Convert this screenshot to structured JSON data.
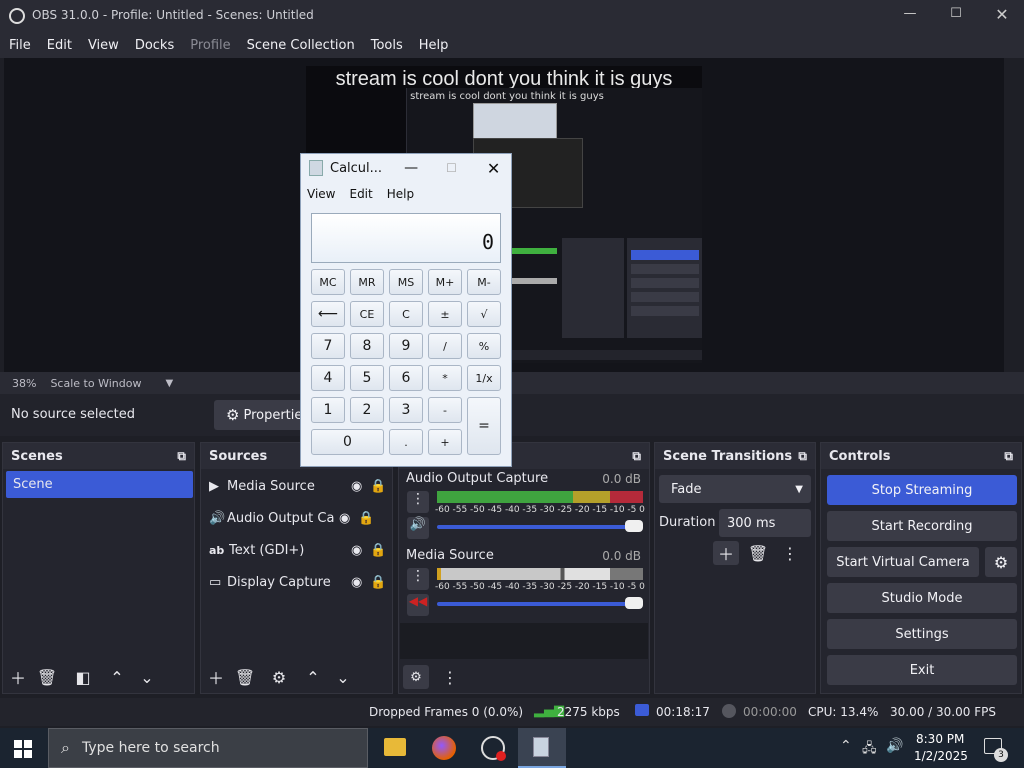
{
  "window": {
    "title": "OBS 31.0.0 - Profile: Untitled - Scenes: Untitled"
  },
  "menu": [
    "File",
    "Edit",
    "View",
    "Docks",
    "Profile",
    "Scene Collection",
    "Tools",
    "Help"
  ],
  "preview": {
    "overlay_text": "stream is cool dont you think it is guys",
    "inner_text": "stream is cool dont you think it is guys"
  },
  "zoom": {
    "value": "38%",
    "mode": "Scale to Window"
  },
  "source_bar": {
    "status": "No source selected",
    "properties_label": "Properties"
  },
  "scenes": {
    "title": "Scenes",
    "items": [
      "Scene"
    ]
  },
  "sources": {
    "title": "Sources",
    "items": [
      {
        "icon": "play-icon",
        "label": "Media Source"
      },
      {
        "icon": "speaker-icon",
        "label": "Audio Output Cap"
      },
      {
        "icon": "text-icon",
        "label": "Text (GDI+)"
      },
      {
        "icon": "monitor-icon",
        "label": "Display Capture"
      }
    ]
  },
  "mixer": {
    "channels": [
      {
        "name": "Audio Output Capture",
        "db": "0.0 dB"
      },
      {
        "name": "Media Source",
        "db": "0.0 dB"
      }
    ],
    "scale": [
      "-60",
      "-55",
      "-50",
      "-45",
      "-40",
      "-35",
      "-30",
      "-25",
      "-20",
      "-15",
      "-10",
      "-5",
      "0"
    ]
  },
  "transitions": {
    "title": "Scene Transitions",
    "selected": "Fade",
    "duration_label": "Duration",
    "duration_value": "300 ms"
  },
  "controls": {
    "title": "Controls",
    "buttons": [
      "Stop Streaming",
      "Start Recording",
      "Start Virtual Camera",
      "Studio Mode",
      "Settings",
      "Exit"
    ]
  },
  "status": {
    "dropped": "Dropped Frames 0 (0.0%)",
    "bitrate": "2275 kbps",
    "stream_time": "00:18:17",
    "rec_time": "00:00:00",
    "cpu": "CPU: 13.4%",
    "fps": "30.00 / 30.00 FPS"
  },
  "calculator": {
    "title": "Calcul...",
    "menu": [
      "View",
      "Edit",
      "Help"
    ],
    "display": "0",
    "keys": [
      [
        "MC",
        "MR",
        "MS",
        "M+",
        "M-"
      ],
      [
        "⟵",
        "CE",
        "C",
        "±",
        "√"
      ],
      [
        "7",
        "8",
        "9",
        "/",
        "%"
      ],
      [
        "4",
        "5",
        "6",
        "*",
        "1/x"
      ],
      [
        "1",
        "2",
        "3",
        "-",
        "="
      ],
      [
        "0",
        ".",
        "+"
      ]
    ]
  },
  "taskbar": {
    "search_placeholder": "Type here to search",
    "time": "8:30 PM",
    "date": "1/2/2025",
    "notifications": "3"
  },
  "colors": {
    "accent": "#3b5bd6",
    "panel": "#24252e",
    "background": "#1e1f26"
  }
}
